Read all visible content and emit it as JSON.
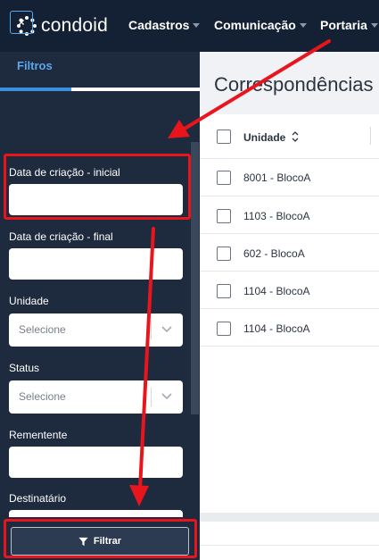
{
  "brand": {
    "name": "condoid"
  },
  "nav": [
    {
      "label": "Cadastros"
    },
    {
      "label": "Comunicação"
    },
    {
      "label": "Portaria"
    }
  ],
  "panel": {
    "close_label": "×",
    "tab_label": "Filtros",
    "fields": {
      "created_from": {
        "label": "Data de criação - inicial",
        "value": ""
      },
      "created_to": {
        "label": "Data de criação - final",
        "value": ""
      },
      "unit": {
        "label": "Unidade",
        "selected": "Selecione"
      },
      "status": {
        "label": "Status",
        "selected": "Selecione"
      },
      "sender": {
        "label": "Rementente",
        "value": ""
      },
      "recipient": {
        "label": "Destinatário",
        "value": ""
      }
    },
    "filter_button_label": "Filtrar"
  },
  "main": {
    "title": "Correspondências",
    "table": {
      "columns": [
        {
          "label": "Unidade"
        }
      ],
      "rows": [
        {
          "unit": "8001 - BlocoA"
        },
        {
          "unit": "1103 - BlocoA"
        },
        {
          "unit": "602 - BlocoA"
        },
        {
          "unit": "1104 - BlocoA"
        },
        {
          "unit": "1104 - BlocoA"
        }
      ]
    }
  },
  "colors": {
    "topbar": "#142033",
    "panel": "#1e2a3e",
    "accent": "#3d8fe0",
    "annotation": "#e8161c"
  },
  "icons": {
    "logo": "condoid-logo-icon",
    "close": "close-icon",
    "chevron": "chevron-down-icon",
    "sort": "sort-icon",
    "filter": "filter-funnel-icon"
  }
}
